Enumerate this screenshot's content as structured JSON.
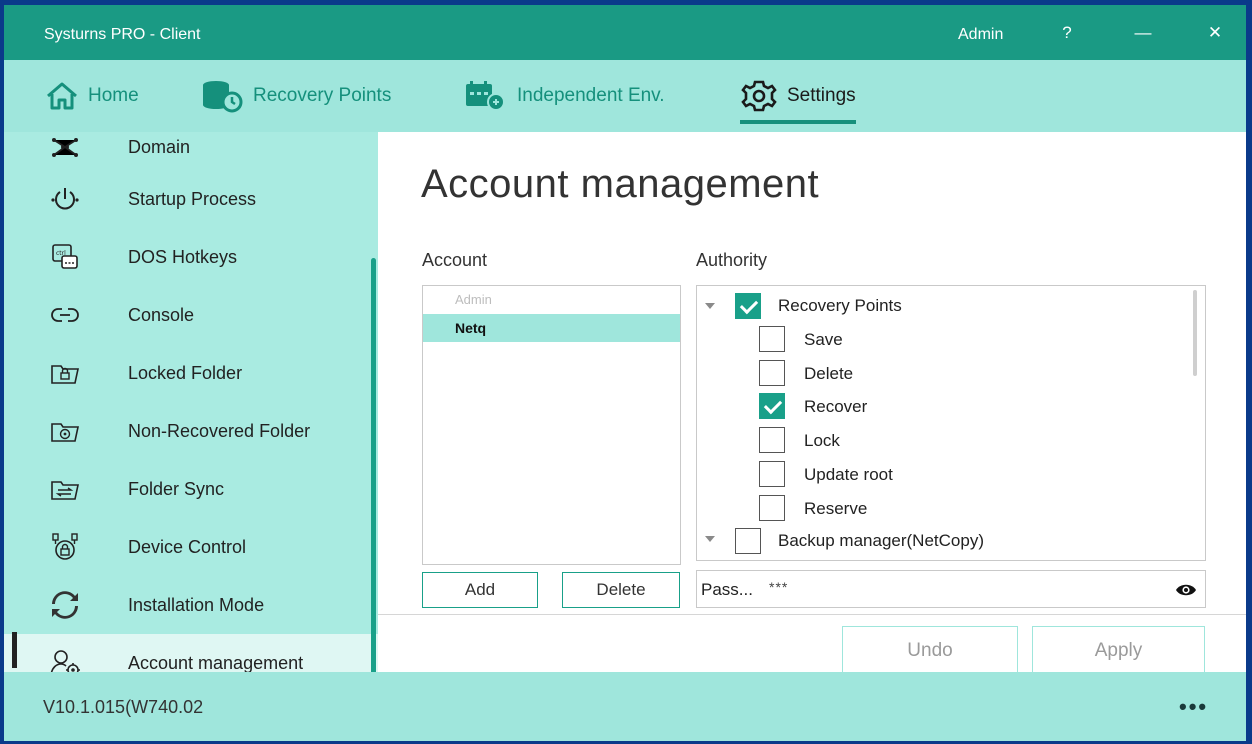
{
  "titlebar": {
    "title": "Systurns PRO - Client",
    "user": "Admin",
    "help": "?",
    "minimize": "—",
    "close": "✕"
  },
  "nav": {
    "tabs": [
      {
        "label": "Home",
        "icon": "home-icon"
      },
      {
        "label": "Recovery Points",
        "icon": "recovery-points-icon"
      },
      {
        "label": "Independent Env.",
        "icon": "calendar-icon"
      },
      {
        "label": "Settings",
        "icon": "gear-icon",
        "active": true
      }
    ]
  },
  "sidebar": {
    "items": [
      {
        "label": "Domain",
        "icon": "network-icon"
      },
      {
        "label": "Startup Process",
        "icon": "power-icon"
      },
      {
        "label": "DOS Hotkeys",
        "icon": "keyboard-icon"
      },
      {
        "label": "Console",
        "icon": "link-icon"
      },
      {
        "label": "Locked Folder",
        "icon": "locked-folder-icon"
      },
      {
        "label": "Non-Recovered Folder",
        "icon": "non-recovered-folder-icon"
      },
      {
        "label": "Folder Sync",
        "icon": "folder-sync-icon"
      },
      {
        "label": "Device Control",
        "icon": "device-control-icon"
      },
      {
        "label": "Installation Mode",
        "icon": "installation-mode-icon"
      },
      {
        "label": "Account management",
        "icon": "account-gear-icon",
        "active": true
      }
    ]
  },
  "main": {
    "title": "Account management",
    "account_label": "Account",
    "authority_label": "Authority",
    "accounts": [
      {
        "name": "Admin",
        "disabled": true
      },
      {
        "name": "Netq",
        "selected": true
      }
    ],
    "add_label": "Add",
    "delete_label": "Delete",
    "authority": {
      "groups": [
        {
          "label": "Recovery Points",
          "checked": true,
          "expanded": true,
          "children": [
            {
              "label": "Save",
              "checked": false
            },
            {
              "label": "Delete",
              "checked": false
            },
            {
              "label": "Recover",
              "checked": true
            },
            {
              "label": "Lock",
              "checked": false
            },
            {
              "label": "Update root",
              "checked": false
            },
            {
              "label": "Reserve",
              "checked": false
            }
          ]
        },
        {
          "label": "Backup manager(NetCopy)",
          "checked": false,
          "expanded": true
        }
      ]
    },
    "password": {
      "label": "Pass...",
      "value": "***"
    },
    "undo_label": "Undo",
    "apply_label": "Apply"
  },
  "statusbar": {
    "version": "V10.1.015(W740.02",
    "more": "•••"
  },
  "colors": {
    "accent": "#19a089",
    "titlebar": "#1a9a84",
    "nav_bg": "#9fe6dc",
    "sidebar_bg": "#a9ebe1",
    "selection": "#9fe6dc"
  }
}
